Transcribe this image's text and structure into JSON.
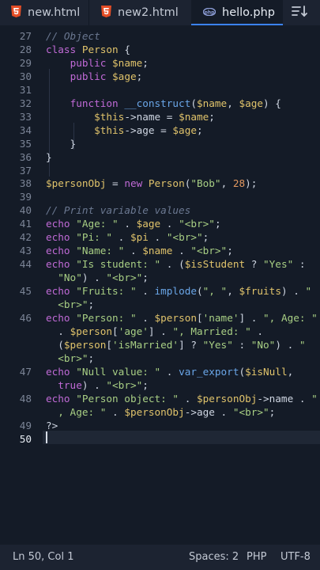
{
  "tabs": [
    {
      "label": "new.html",
      "icon": "html5-icon",
      "active": false
    },
    {
      "label": "new2.html",
      "icon": "html5-icon",
      "active": false
    },
    {
      "label": "hello.php",
      "icon": "php-icon",
      "active": true
    }
  ],
  "toolbar": {
    "sort_icon": "sort-lines-icon"
  },
  "editor": {
    "line_numbers": [
      "27",
      "28",
      "29",
      "30",
      "31",
      "32",
      "33",
      "34",
      "35",
      "36",
      "37",
      "38",
      "39",
      "40",
      "41",
      "42",
      "43",
      "44",
      "45",
      "46",
      "47",
      "48",
      "49",
      "50"
    ],
    "lines": [
      {
        "n": "27",
        "segs": [
          [
            "com",
            "// Object"
          ]
        ]
      },
      {
        "n": "28",
        "segs": [
          [
            "kw",
            "class"
          ],
          [
            "op",
            " "
          ],
          [
            "cls",
            "Person"
          ],
          [
            "op",
            " {"
          ]
        ]
      },
      {
        "n": "29",
        "segs": [
          [
            "op",
            "    "
          ],
          [
            "kw",
            "public"
          ],
          [
            "op",
            " "
          ],
          [
            "var",
            "$name"
          ],
          [
            "op",
            ";"
          ]
        ]
      },
      {
        "n": "30",
        "segs": [
          [
            "op",
            "    "
          ],
          [
            "kw",
            "public"
          ],
          [
            "op",
            " "
          ],
          [
            "var",
            "$age"
          ],
          [
            "op",
            ";"
          ]
        ]
      },
      {
        "n": "31",
        "segs": []
      },
      {
        "n": "32",
        "segs": [
          [
            "op",
            "    "
          ],
          [
            "kw",
            "function"
          ],
          [
            "op",
            " "
          ],
          [
            "fn",
            "__construct"
          ],
          [
            "op",
            "("
          ],
          [
            "var",
            "$name"
          ],
          [
            "op",
            ", "
          ],
          [
            "var",
            "$age"
          ],
          [
            "op",
            ") {"
          ]
        ]
      },
      {
        "n": "33",
        "segs": [
          [
            "op",
            "        "
          ],
          [
            "var",
            "$this"
          ],
          [
            "op",
            "->name = "
          ],
          [
            "var",
            "$name"
          ],
          [
            "op",
            ";"
          ]
        ]
      },
      {
        "n": "34",
        "segs": [
          [
            "op",
            "        "
          ],
          [
            "var",
            "$this"
          ],
          [
            "op",
            "->age = "
          ],
          [
            "var",
            "$age"
          ],
          [
            "op",
            ";"
          ]
        ]
      },
      {
        "n": "35",
        "segs": [
          [
            "op",
            "    }"
          ]
        ]
      },
      {
        "n": "36",
        "segs": [
          [
            "op",
            "}"
          ]
        ]
      },
      {
        "n": "37",
        "segs": []
      },
      {
        "n": "38",
        "segs": [
          [
            "var",
            "$personObj"
          ],
          [
            "op",
            " = "
          ],
          [
            "kw",
            "new"
          ],
          [
            "op",
            " "
          ],
          [
            "cls",
            "Person"
          ],
          [
            "op",
            "("
          ],
          [
            "str",
            "\"Bob\""
          ],
          [
            "op",
            ", "
          ],
          [
            "num",
            "28"
          ],
          [
            "op",
            ");"
          ]
        ]
      },
      {
        "n": "39",
        "segs": []
      },
      {
        "n": "40",
        "segs": [
          [
            "com",
            "// Print variable values"
          ]
        ]
      },
      {
        "n": "41",
        "segs": [
          [
            "kw",
            "echo"
          ],
          [
            "op",
            " "
          ],
          [
            "str",
            "\"Age: \""
          ],
          [
            "op",
            " . "
          ],
          [
            "var",
            "$age"
          ],
          [
            "op",
            " . "
          ],
          [
            "str",
            "\"<br>\""
          ],
          [
            "op",
            ";"
          ]
        ]
      },
      {
        "n": "42",
        "segs": [
          [
            "kw",
            "echo"
          ],
          [
            "op",
            " "
          ],
          [
            "str",
            "\"Pi: \""
          ],
          [
            "op",
            " . "
          ],
          [
            "var",
            "$pi"
          ],
          [
            "op",
            " . "
          ],
          [
            "str",
            "\"<br>\""
          ],
          [
            "op",
            ";"
          ]
        ]
      },
      {
        "n": "43",
        "segs": [
          [
            "kw",
            "echo"
          ],
          [
            "op",
            " "
          ],
          [
            "str",
            "\"Name: \""
          ],
          [
            "op",
            " . "
          ],
          [
            "var",
            "$name"
          ],
          [
            "op",
            " . "
          ],
          [
            "str",
            "\"<br>\""
          ],
          [
            "op",
            ";"
          ]
        ]
      },
      {
        "n": "44",
        "segs": [
          [
            "kw",
            "echo"
          ],
          [
            "op",
            " "
          ],
          [
            "str",
            "\"Is student: \""
          ],
          [
            "op",
            " . ("
          ],
          [
            "var",
            "$isStudent"
          ],
          [
            "op",
            " ? "
          ],
          [
            "str",
            "\"Yes\""
          ],
          [
            "op",
            " :"
          ]
        ]
      },
      {
        "n": "",
        "segs": [
          [
            "op",
            "  "
          ],
          [
            "str",
            "\"No\""
          ],
          [
            "op",
            ") . "
          ],
          [
            "str",
            "\"<br>\""
          ],
          [
            "op",
            ";"
          ]
        ]
      },
      {
        "n": "45",
        "segs": [
          [
            "kw",
            "echo"
          ],
          [
            "op",
            " "
          ],
          [
            "str",
            "\"Fruits: \""
          ],
          [
            "op",
            " . "
          ],
          [
            "fn",
            "implode"
          ],
          [
            "op",
            "("
          ],
          [
            "str",
            "\", \""
          ],
          [
            "op",
            ", "
          ],
          [
            "var",
            "$fruits"
          ],
          [
            "op",
            ") . "
          ],
          [
            "str",
            "\""
          ]
        ]
      },
      {
        "n": "",
        "segs": [
          [
            "op",
            "  "
          ],
          [
            "str",
            "<br>\""
          ],
          [
            "op",
            ";"
          ]
        ]
      },
      {
        "n": "46",
        "segs": [
          [
            "kw",
            "echo"
          ],
          [
            "op",
            " "
          ],
          [
            "str",
            "\"Person: \""
          ],
          [
            "op",
            " . "
          ],
          [
            "var",
            "$person"
          ],
          [
            "op",
            "["
          ],
          [
            "str",
            "'name'"
          ],
          [
            "op",
            "] . "
          ],
          [
            "str",
            "\", Age: \""
          ]
        ]
      },
      {
        "n": "",
        "segs": [
          [
            "op",
            "  . "
          ],
          [
            "var",
            "$person"
          ],
          [
            "op",
            "["
          ],
          [
            "str",
            "'age'"
          ],
          [
            "op",
            "] . "
          ],
          [
            "str",
            "\", Married: \""
          ],
          [
            "op",
            " ."
          ]
        ]
      },
      {
        "n": "",
        "segs": [
          [
            "op",
            "  ("
          ],
          [
            "var",
            "$person"
          ],
          [
            "op",
            "["
          ],
          [
            "str",
            "'isMarried'"
          ],
          [
            "op",
            "] ? "
          ],
          [
            "str",
            "\"Yes\""
          ],
          [
            "op",
            " : "
          ],
          [
            "str",
            "\"No\""
          ],
          [
            "op",
            ") . "
          ],
          [
            "str",
            "\""
          ]
        ]
      },
      {
        "n": "",
        "segs": [
          [
            "op",
            "  "
          ],
          [
            "str",
            "<br>\""
          ],
          [
            "op",
            ";"
          ]
        ]
      },
      {
        "n": "47",
        "segs": [
          [
            "kw",
            "echo"
          ],
          [
            "op",
            " "
          ],
          [
            "str",
            "\"Null value: \""
          ],
          [
            "op",
            " . "
          ],
          [
            "fn",
            "var_export"
          ],
          [
            "op",
            "("
          ],
          [
            "var",
            "$isNull"
          ],
          [
            "op",
            ","
          ]
        ]
      },
      {
        "n": "",
        "segs": [
          [
            "op",
            "  "
          ],
          [
            "kw",
            "true"
          ],
          [
            "op",
            ") . "
          ],
          [
            "str",
            "\"<br>\""
          ],
          [
            "op",
            ";"
          ]
        ]
      },
      {
        "n": "48",
        "segs": [
          [
            "kw",
            "echo"
          ],
          [
            "op",
            " "
          ],
          [
            "str",
            "\"Person object: \""
          ],
          [
            "op",
            " . "
          ],
          [
            "var",
            "$personObj"
          ],
          [
            "op",
            "->name . "
          ],
          [
            "str",
            "\""
          ]
        ]
      },
      {
        "n": "",
        "segs": [
          [
            "op",
            "  "
          ],
          [
            "str",
            ", Age: \""
          ],
          [
            "op",
            " . "
          ],
          [
            "var",
            "$personObj"
          ],
          [
            "op",
            "->age . "
          ],
          [
            "str",
            "\"<br>\""
          ],
          [
            "op",
            ";"
          ]
        ]
      },
      {
        "n": "49",
        "segs": [
          [
            "tag",
            "?>"
          ]
        ]
      },
      {
        "n": "50",
        "segs": []
      }
    ]
  },
  "status": {
    "position": "Ln 50, Col 1",
    "indent": "Spaces: 2",
    "language": "PHP",
    "encoding": "UTF-8"
  },
  "colors": {
    "accent": "#3b82f6",
    "background": "#141b27",
    "tabbar": "#1c2331"
  }
}
